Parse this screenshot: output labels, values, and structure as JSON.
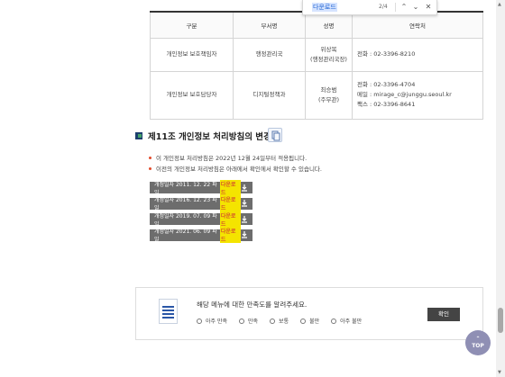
{
  "find_bar": {
    "query": "다운로드",
    "count": "2/4"
  },
  "table": {
    "headers": [
      "구분",
      "부서명",
      "성명",
      "연락처"
    ],
    "rows": [
      {
        "type": "개인정보 보호책임자",
        "dept": "행정관리국",
        "name": "위상복",
        "name_sub": "(행정관리국장)",
        "contact": [
          "전화 : 02-3396-8210"
        ]
      },
      {
        "type": "개인정보 보호담당자",
        "dept": "디지털정책과",
        "name": "최승범",
        "name_sub": "(주무관)",
        "contact": [
          "전화 : 02-3396-4704",
          "메일 : mirage_c@junggu.seoul.kr",
          "팩스 : 02-3396-8641"
        ]
      }
    ]
  },
  "section": {
    "title": "제11조 개인정보 처리방침의 변경",
    "bullets": [
      "이 개인정보 처리방침은 2022년 12월 24일부터 적용됩니다.",
      "이전의 개인정보 처리방침은 아래에서 확인에서 확인할 수 있습니다."
    ]
  },
  "downloads": [
    {
      "label": "개정일자 2011. 12. 22 파일",
      "link": "다운로드"
    },
    {
      "label": "개정일자 2016. 12. 23 파일",
      "link": "다운로드"
    },
    {
      "label": "개정일자 2019. 07. 09 파일",
      "link": "다운로드"
    },
    {
      "label": "개정일자 2021. 06. 09 파일",
      "link": "다운로드"
    }
  ],
  "feedback": {
    "question": "해당 메뉴에 대한 만족도를 알려주세요.",
    "options": [
      "아주 만족",
      "만족",
      "보통",
      "불만",
      "아주 불만"
    ],
    "submit": "확인"
  },
  "top_button": {
    "label": "TOP"
  },
  "colors": {
    "accent_bullet": "#e24a2b",
    "download_bg": "#6d6d6d",
    "highlight": "#f4e400",
    "top_button": "#8f8fb4"
  }
}
